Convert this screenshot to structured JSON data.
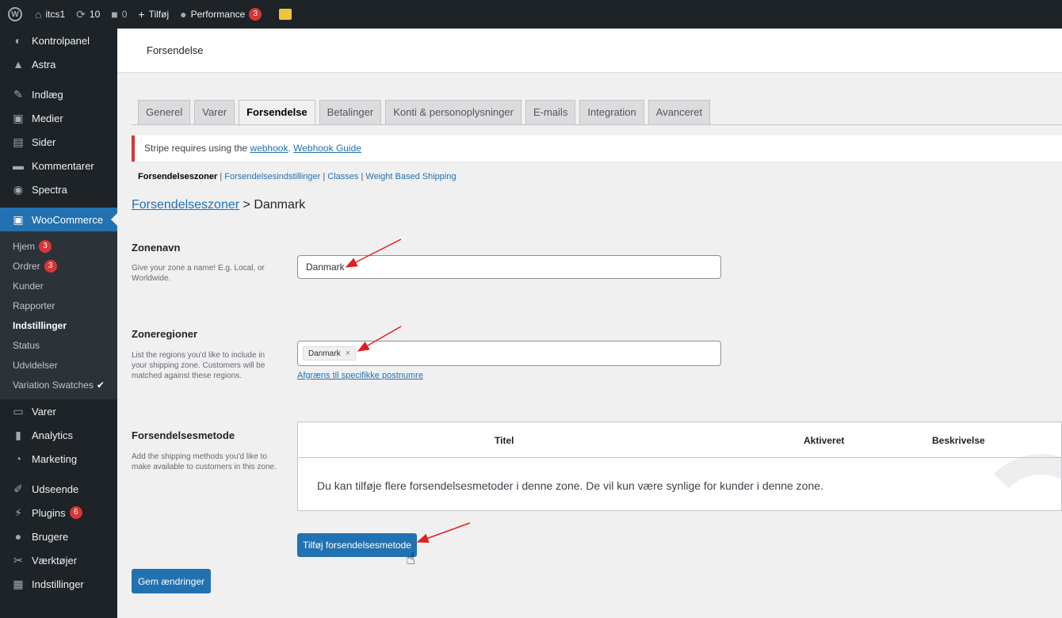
{
  "adminbar": {
    "wp_logo_icon": "wordpress-logo-icon",
    "site_name": "itcs1",
    "updates_count": "10",
    "comments_count": "0",
    "new_label": "Tilføj",
    "performance_label": "Performance",
    "performance_badge": "3"
  },
  "sidebar": {
    "items_top": [
      {
        "label": "Kontrolpanel",
        "icon": "dashboard-icon"
      },
      {
        "label": "Astra",
        "icon": "astra-icon"
      },
      {
        "label": "Indlæg",
        "icon": "pin-icon"
      },
      {
        "label": "Medier",
        "icon": "media-icon"
      },
      {
        "label": "Sider",
        "icon": "pages-icon"
      },
      {
        "label": "Kommentarer",
        "icon": "comments-icon"
      },
      {
        "label": "Spectra",
        "icon": "spectra-icon"
      }
    ],
    "woocommerce_label": "WooCommerce",
    "submenu": [
      {
        "label": "Hjem",
        "badge": "3"
      },
      {
        "label": "Ordrer",
        "badge": "3"
      },
      {
        "label": "Kunder"
      },
      {
        "label": "Rapporter"
      },
      {
        "label": "Indstillinger",
        "current": true
      },
      {
        "label": "Status"
      },
      {
        "label": "Udvidelser"
      },
      {
        "label": "Variation Swatches"
      }
    ],
    "items_bottom": [
      {
        "label": "Varer",
        "icon": "products-icon"
      },
      {
        "label": "Analytics",
        "icon": "analytics-icon"
      },
      {
        "label": "Marketing",
        "icon": "marketing-icon"
      },
      {
        "label": "Udseende",
        "icon": "appearance-icon"
      },
      {
        "label": "Plugins",
        "icon": "plugins-icon",
        "badge": "6"
      },
      {
        "label": "Brugere",
        "icon": "users-icon"
      },
      {
        "label": "Værktøjer",
        "icon": "tools-icon"
      },
      {
        "label": "Indstillinger",
        "icon": "settings-icon"
      }
    ]
  },
  "header": {
    "title": "Forsendelse"
  },
  "tabs": [
    "Generel",
    "Varer",
    "Forsendelse",
    "Betalinger",
    "Konti & personoplysninger",
    "E-mails",
    "Integration",
    "Avanceret"
  ],
  "notice": {
    "prefix": "Stripe requires using the ",
    "link1": "webhook",
    "sep": ". ",
    "link2": "Webhook Guide"
  },
  "subsub": {
    "current": "Forsendelseszoner",
    "links": [
      "Forsendelsesindstillinger",
      "Classes",
      "Weight Based Shipping"
    ]
  },
  "crumb": {
    "link": "Forsendelseszoner",
    "rest": " > Danmark"
  },
  "zone_name": {
    "label": "Zonenavn",
    "desc": "Give your zone a name! E.g. Local, or Worldwide.",
    "value": "Danmark"
  },
  "zone_regions": {
    "label": "Zoneregioner",
    "desc": "List the regions you'd like to include in your shipping zone. Customers will be matched against these regions.",
    "chip": "Danmark",
    "limit_link": "Afgræns til specifikke postnumre"
  },
  "methods": {
    "label": "Forsendelsesmetode",
    "desc": "Add the shipping methods you'd like to make available to customers in this zone.",
    "col_title": "Titel",
    "col_enabled": "Aktiveret",
    "col_desc": "Beskrivelse",
    "empty": "Du kan tilføje flere forsendelsesmetoder i denne zone. De vil kun være synlige for kunder i denne zone.",
    "add_button": "Tilføj forsendelsesmetode"
  },
  "save_button": "Gem ændringer",
  "colors": {
    "accent": "#2271b1",
    "admin_dark": "#1d2327",
    "badge": "#d63638",
    "arrow": "#e02020"
  }
}
